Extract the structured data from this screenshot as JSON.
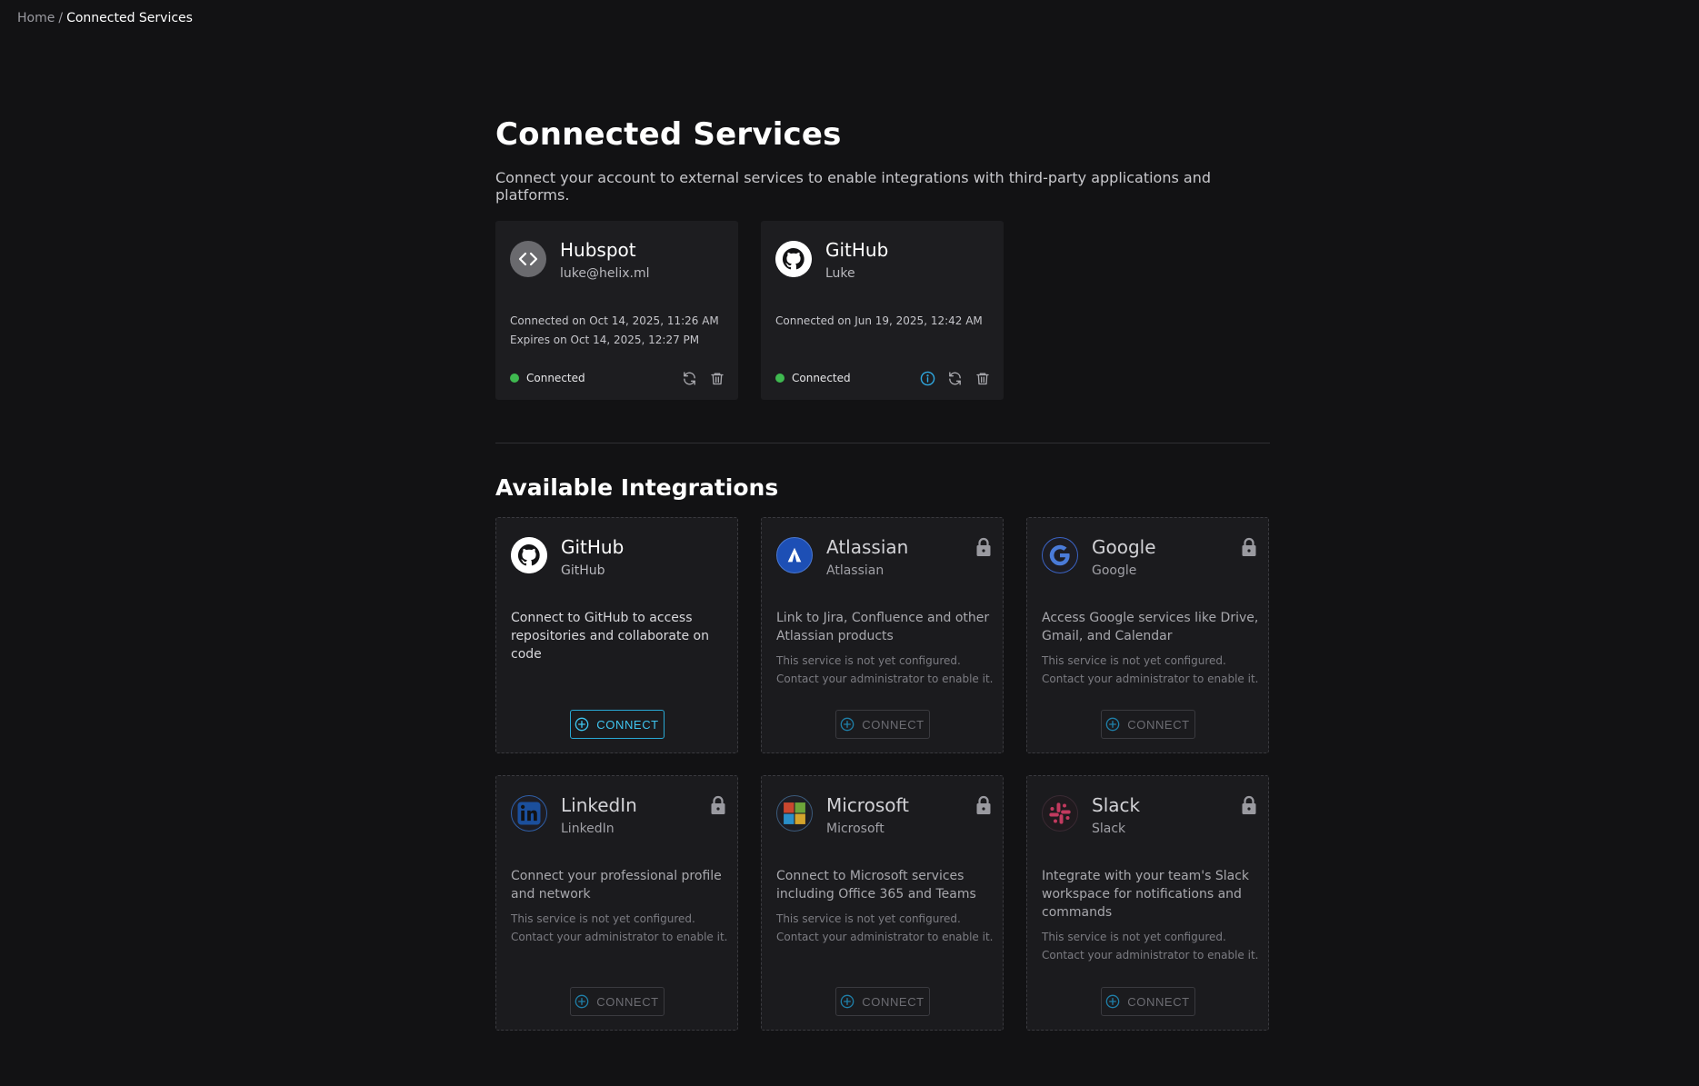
{
  "breadcrumb": {
    "home": "Home",
    "separator": "/",
    "current": "Connected Services"
  },
  "page": {
    "title": "Connected Services",
    "subtitle": "Connect your account to external services to enable integrations with third-party applications and platforms."
  },
  "connected": [
    {
      "name": "Hubspot",
      "account": "luke@helix.ml",
      "icon": "code-brackets-icon",
      "connected_on": "Connected on Oct 14, 2025, 11:26 AM",
      "expires_on": "Expires on Oct 14, 2025, 12:27 PM",
      "status": "Connected"
    },
    {
      "name": "GitHub",
      "account": "Luke",
      "icon": "github-icon",
      "connected_on": "Connected on Jun 19, 2025, 12:42 AM",
      "expires_on": "",
      "status": "Connected"
    }
  ],
  "available_title": "Available Integrations",
  "integrations": [
    {
      "name": "GitHub",
      "sub": "GitHub",
      "icon": "github-icon",
      "locked": false,
      "description": "Connect to GitHub to access repositories and collaborate on code",
      "note": "",
      "button": "CONNECT"
    },
    {
      "name": "Atlassian",
      "sub": "Atlassian",
      "icon": "atlassian-icon",
      "locked": true,
      "description": "Link to Jira, Confluence and other Atlassian products",
      "note": "This service is not yet configured. Contact your administrator to enable it.",
      "button": "CONNECT"
    },
    {
      "name": "Google",
      "sub": "Google",
      "icon": "google-icon",
      "locked": true,
      "description": "Access Google services like Drive, Gmail, and Calendar",
      "note": "This service is not yet configured. Contact your administrator to enable it.",
      "button": "CONNECT"
    },
    {
      "name": "LinkedIn",
      "sub": "LinkedIn",
      "icon": "linkedin-icon",
      "locked": true,
      "description": "Connect your professional profile and network",
      "note": "This service is not yet configured. Contact your administrator to enable it.",
      "button": "CONNECT"
    },
    {
      "name": "Microsoft",
      "sub": "Microsoft",
      "icon": "microsoft-icon",
      "locked": true,
      "description": "Connect to Microsoft services including Office 365 and Teams",
      "note": "This service is not yet configured. Contact your administrator to enable it.",
      "button": "CONNECT"
    },
    {
      "name": "Slack",
      "sub": "Slack",
      "icon": "slack-icon",
      "locked": true,
      "description": "Integrate with your team's Slack workspace for notifications and commands",
      "note": "This service is not yet configured. Contact your administrator to enable it.",
      "button": "CONNECT"
    }
  ],
  "colors": {
    "accent": "#29a8d4",
    "status_connected": "#3fb950",
    "background": "#121214",
    "card": "#1d1d20"
  }
}
